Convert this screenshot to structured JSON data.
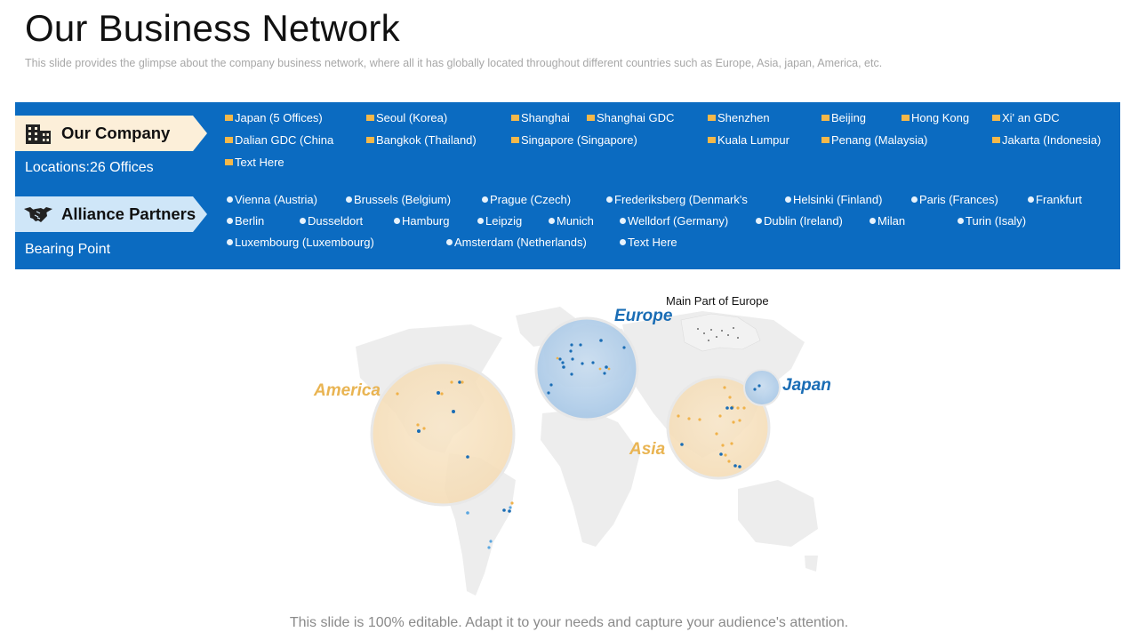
{
  "header": {
    "title": "Our Business Network",
    "subtitle": "This slide provides  the glimpse about the company business network,  where  all it has globally located throughout  different  countries such as Europe, Asia, japan, America, etc."
  },
  "company": {
    "label": "Our Company",
    "icon": "building-icon",
    "note": "Locations:26 Offices",
    "locations": [
      "Japan  (5 Offices)",
      "Seoul (Korea)",
      "Shanghai",
      "Shanghai GDC",
      "Shenzhen",
      "Beijing",
      "Hong Kong",
      "Xi' an GDC",
      "Dalian GDC  (China",
      "Bangkok (Thailand)",
      "Singapore  (Singapore)",
      "Kuala Lumpur",
      "Penang (Malaysia)",
      "Jakarta (Indonesia)",
      "Text Here"
    ]
  },
  "partners": {
    "label": "Alliance Partners",
    "icon": "handshake-icon",
    "note": "Bearing Point",
    "locations": [
      "Vienna (Austria)",
      "Brussels (Belgium)",
      "Prague  (Czech)",
      "Frederiksberg  (Denmark's",
      "Helsinki (Finland)",
      "Paris (Frances)",
      "Frankfurt",
      "Berlin",
      "Dusseldort",
      "Hamburg",
      "Leipzig",
      "Munich",
      "Welldorf (Germany)",
      "Dublin (Ireland)",
      "Milan",
      "Turin  (Isaly)",
      "Luxembourg  (Luxembourg)",
      "Amsterdam (Netherlands)",
      "Text Here"
    ]
  },
  "map": {
    "inset_label": "Main Part of Europe",
    "regions": {
      "europe": "Europe",
      "america": "America",
      "asia": "Asia",
      "japan": "Japan"
    }
  },
  "footer": "This slide is 100% editable. Adapt it to your needs and capture your audience's attention.",
  "colors": {
    "band": "#0B6BC1",
    "company_tag": "#FCEFD9",
    "partner_tag": "#CFE6F8",
    "accent_orange": "#F4B84A",
    "accent_blue": "#1A6DB5",
    "label_orange": "#E9B452"
  }
}
